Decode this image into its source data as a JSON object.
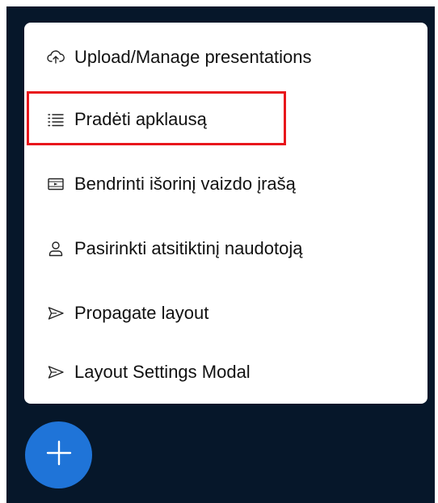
{
  "menu": {
    "items": [
      {
        "label": "Upload/Manage presentations",
        "icon": "cloud-upload-icon"
      },
      {
        "label": "Pradėti apklausą",
        "icon": "list-icon"
      },
      {
        "label": "Bendrinti išorinį vaizdo įrašą",
        "icon": "video-frame-icon"
      },
      {
        "label": "Pasirinkti atsitiktinį naudotoją",
        "icon": "user-icon"
      },
      {
        "label": "Propagate layout",
        "icon": "send-icon"
      },
      {
        "label": "Layout Settings Modal",
        "icon": "send-icon"
      }
    ]
  },
  "fab": {
    "icon": "plus-icon"
  },
  "colors": {
    "background": "#06172a",
    "menu_background": "#ffffff",
    "fab": "#1f74d8",
    "highlight": "#e8161b",
    "text": "#111111"
  }
}
